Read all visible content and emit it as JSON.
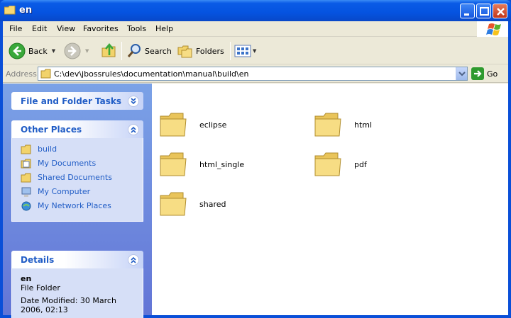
{
  "window": {
    "title": "en"
  },
  "menu": [
    "File",
    "Edit",
    "View",
    "Favorites",
    "Tools",
    "Help"
  ],
  "toolbar": {
    "back": "Back",
    "search": "Search",
    "folders": "Folders"
  },
  "address": {
    "label": "Address",
    "path": "C:\\dev\\jbossrules\\documentation\\manual\\build\\en",
    "go": "Go"
  },
  "tasks": {
    "file_folder_title": "File and Folder Tasks",
    "other_places_title": "Other Places",
    "places": [
      {
        "label": "build",
        "icon": "folder-icon"
      },
      {
        "label": "My Documents",
        "icon": "my-documents-icon"
      },
      {
        "label": "Shared Documents",
        "icon": "folder-icon"
      },
      {
        "label": "My Computer",
        "icon": "my-computer-icon"
      },
      {
        "label": "My Network Places",
        "icon": "network-icon"
      }
    ],
    "details_title": "Details",
    "details": {
      "name": "en",
      "type": "File Folder",
      "modified": "Date Modified: 30 March 2006, 02:13"
    }
  },
  "items": [
    {
      "name": "eclipse"
    },
    {
      "name": "html"
    },
    {
      "name": "html_single"
    },
    {
      "name": "pdf"
    },
    {
      "name": "shared"
    }
  ],
  "colors": {
    "titlebar": "#0553e0",
    "link": "#215dc6",
    "panel_body": "#d6dff7",
    "folder": "#f2d36b"
  }
}
